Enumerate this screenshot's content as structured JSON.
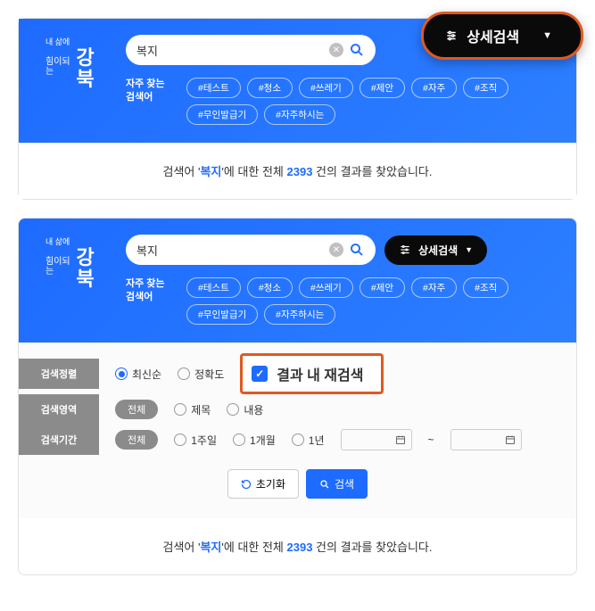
{
  "search": {
    "value": "복지"
  },
  "adv_label": "상세검색",
  "freq_label": "자주 찾는\n검색어",
  "tags": [
    "#테스트",
    "#청소",
    "#쓰레기",
    "#제안",
    "#자주",
    "#조직",
    "#무인발급기",
    "#자주하시는"
  ],
  "result": {
    "prefix": "검색어 '",
    "keyword": "복지",
    "mid": "'에 대한 전체 ",
    "count": "2393",
    "suffix": " 건의 결과를 찾았습니다."
  },
  "filters": {
    "sort_label": "검색정렬",
    "sort_opts": {
      "recent": "최신순",
      "accuracy": "정확도"
    },
    "refine_label": "결과 내 재검색",
    "area_label": "검색영역",
    "area_all": "전체",
    "area_opts": {
      "title": "제목",
      "content": "내용"
    },
    "period_label": "검색기간",
    "period_all": "전체",
    "period_opts": {
      "w1": "1주일",
      "m1": "1개월",
      "y1": "1년"
    },
    "tilde": "~"
  },
  "buttons": {
    "reset": "초기화",
    "search": "검색"
  },
  "logo": {
    "small": "내 삶에",
    "mid": "힘이되는",
    "big": "강북"
  }
}
